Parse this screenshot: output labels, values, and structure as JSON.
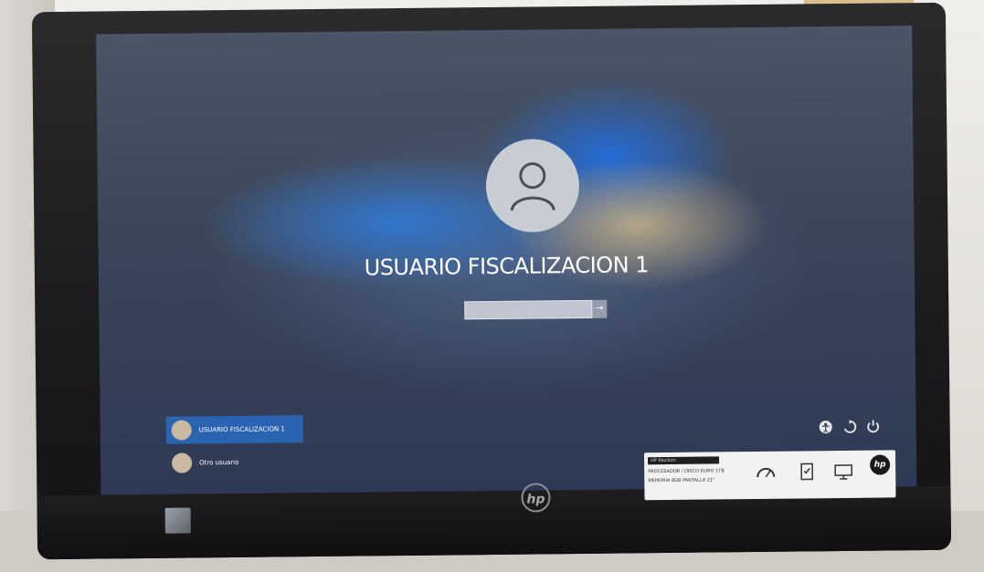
{
  "lockscreen": {
    "username": "USUARIO FISCALIZACION 1",
    "password": {
      "value": "",
      "placeholder": ""
    },
    "user_list": [
      {
        "label": "USUARIO FISCALIZACION 1",
        "selected": true
      },
      {
        "label": "Otro usuario",
        "selected": false
      }
    ],
    "system_icons": [
      "accessibility-icon",
      "ease-of-access-icon",
      "power-icon"
    ]
  },
  "monitor": {
    "brand": "hp",
    "sticker": {
      "line1": "HP Pavilion",
      "line2": "PROCESADOR / DISCO DURO 1TB",
      "line3": "MEMORIA 8GB  PANTALLA 21\""
    }
  },
  "colors": {
    "accent": "#2f6fc8",
    "text": "#ffffff"
  }
}
